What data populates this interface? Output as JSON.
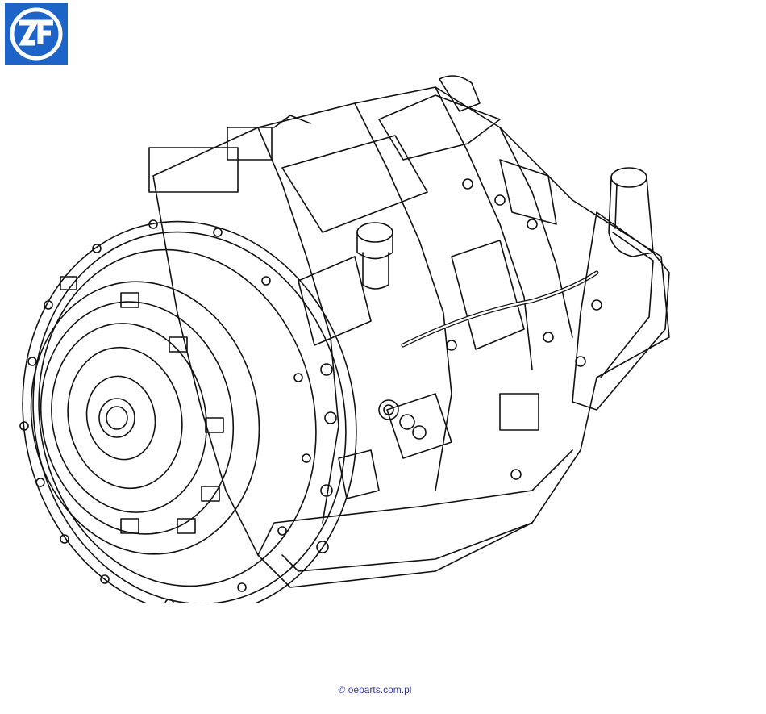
{
  "logo": {
    "text": "ZF",
    "color": "#1e63c8"
  },
  "watermark": {
    "text": "© oeparts.com.pl"
  },
  "drawing": {
    "subject": "transmission-assembly-line-drawing",
    "stroke_color": "#111111",
    "background": "#ffffff"
  }
}
